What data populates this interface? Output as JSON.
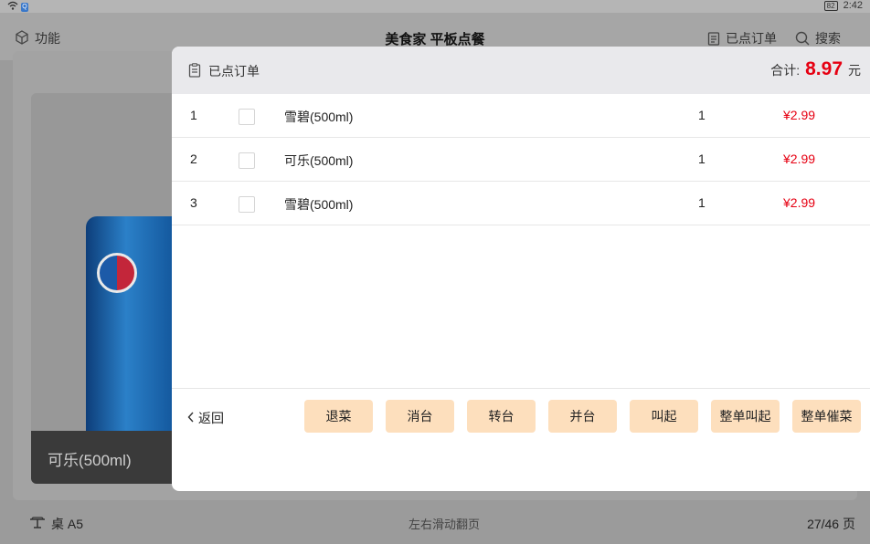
{
  "status": {
    "battery": "82",
    "time": "2:42"
  },
  "topbar": {
    "func_label": "功能",
    "title": "美食家 平板点餐",
    "orders_label": "已点订单",
    "search_label": "搜索"
  },
  "product": {
    "name": "可乐(500ml)"
  },
  "bottom": {
    "table": "桌 A5",
    "hint": "左右滑动翻页",
    "pages": "27/46 页"
  },
  "modal": {
    "title": "已点订单",
    "total_label": "合计:",
    "total_amount": "8.97",
    "total_unit": "元",
    "items": [
      {
        "idx": "1",
        "name": "雪碧(500ml)",
        "qty": "1",
        "price": "¥2.99"
      },
      {
        "idx": "2",
        "name": "可乐(500ml)",
        "qty": "1",
        "price": "¥2.99"
      },
      {
        "idx": "3",
        "name": "雪碧(500ml)",
        "qty": "1",
        "price": "¥2.99"
      }
    ],
    "back_label": "返回",
    "buttons": [
      "退菜",
      "消台",
      "转台",
      "并台",
      "叫起",
      "整单叫起",
      "整单催菜"
    ]
  },
  "colors": {
    "accent_red": "#e60012",
    "button_bg": "#fddfbd"
  }
}
